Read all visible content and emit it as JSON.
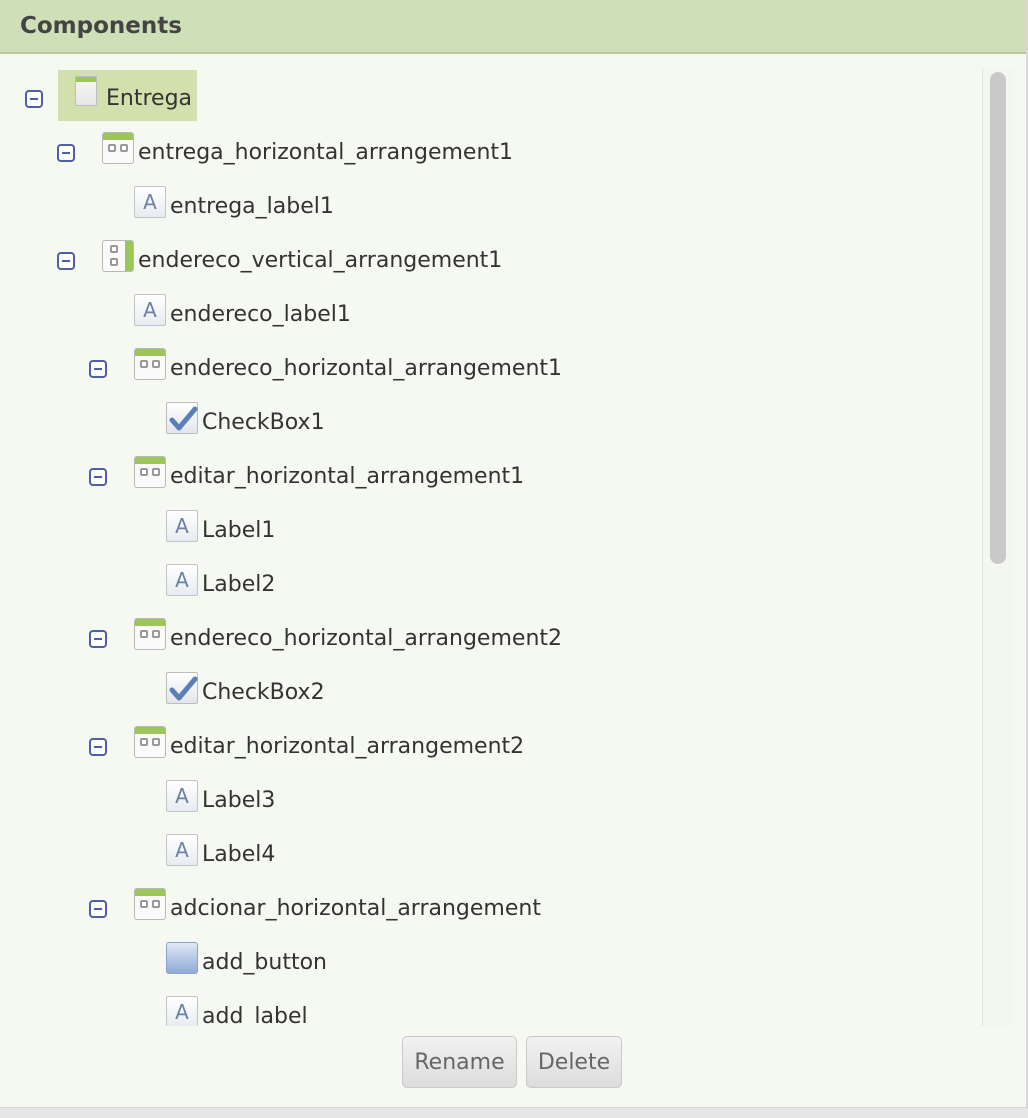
{
  "panel": {
    "title": "Components"
  },
  "tree": [
    {
      "label": "Entrega",
      "icon": "screen-icon",
      "level": 0,
      "expanded": true,
      "selected": true
    },
    {
      "label": "entrega_horizontal_arrangement1",
      "icon": "horizontal-arrangement-icon",
      "level": 1,
      "expanded": true
    },
    {
      "label": "entrega_label1",
      "icon": "label-icon",
      "level": 2
    },
    {
      "label": "endereco_vertical_arrangement1",
      "icon": "vertical-arrangement-icon",
      "level": 1,
      "expanded": true
    },
    {
      "label": "endereco_label1",
      "icon": "label-icon",
      "level": 2
    },
    {
      "label": "endereco_horizontal_arrangement1",
      "icon": "horizontal-arrangement-icon",
      "level": 2,
      "expanded": true
    },
    {
      "label": "CheckBox1",
      "icon": "checkbox-icon",
      "level": 3
    },
    {
      "label": "editar_horizontal_arrangement1",
      "icon": "horizontal-arrangement-icon",
      "level": 2,
      "expanded": true
    },
    {
      "label": "Label1",
      "icon": "label-icon",
      "level": 3
    },
    {
      "label": "Label2",
      "icon": "label-icon",
      "level": 3
    },
    {
      "label": "endereco_horizontal_arrangement2",
      "icon": "horizontal-arrangement-icon",
      "level": 2,
      "expanded": true
    },
    {
      "label": "CheckBox2",
      "icon": "checkbox-icon",
      "level": 3
    },
    {
      "label": "editar_horizontal_arrangement2",
      "icon": "horizontal-arrangement-icon",
      "level": 2,
      "expanded": true
    },
    {
      "label": "Label3",
      "icon": "label-icon",
      "level": 3
    },
    {
      "label": "Label4",
      "icon": "label-icon",
      "level": 3
    },
    {
      "label": "adcionar_horizontal_arrangement",
      "icon": "horizontal-arrangement-icon",
      "level": 2,
      "expanded": true
    },
    {
      "label": "add_button",
      "icon": "button-icon",
      "level": 3
    },
    {
      "label": "add_label",
      "icon": "label-icon",
      "level": 3
    }
  ],
  "actions": {
    "rename_label": "Rename",
    "delete_label": "Delete"
  },
  "colors": {
    "header_bg": "#cfdfb7",
    "selection_bg": "#d2e0ad",
    "toggle": "#4f5fa6",
    "arrangement_accent": "#9cc65a"
  }
}
